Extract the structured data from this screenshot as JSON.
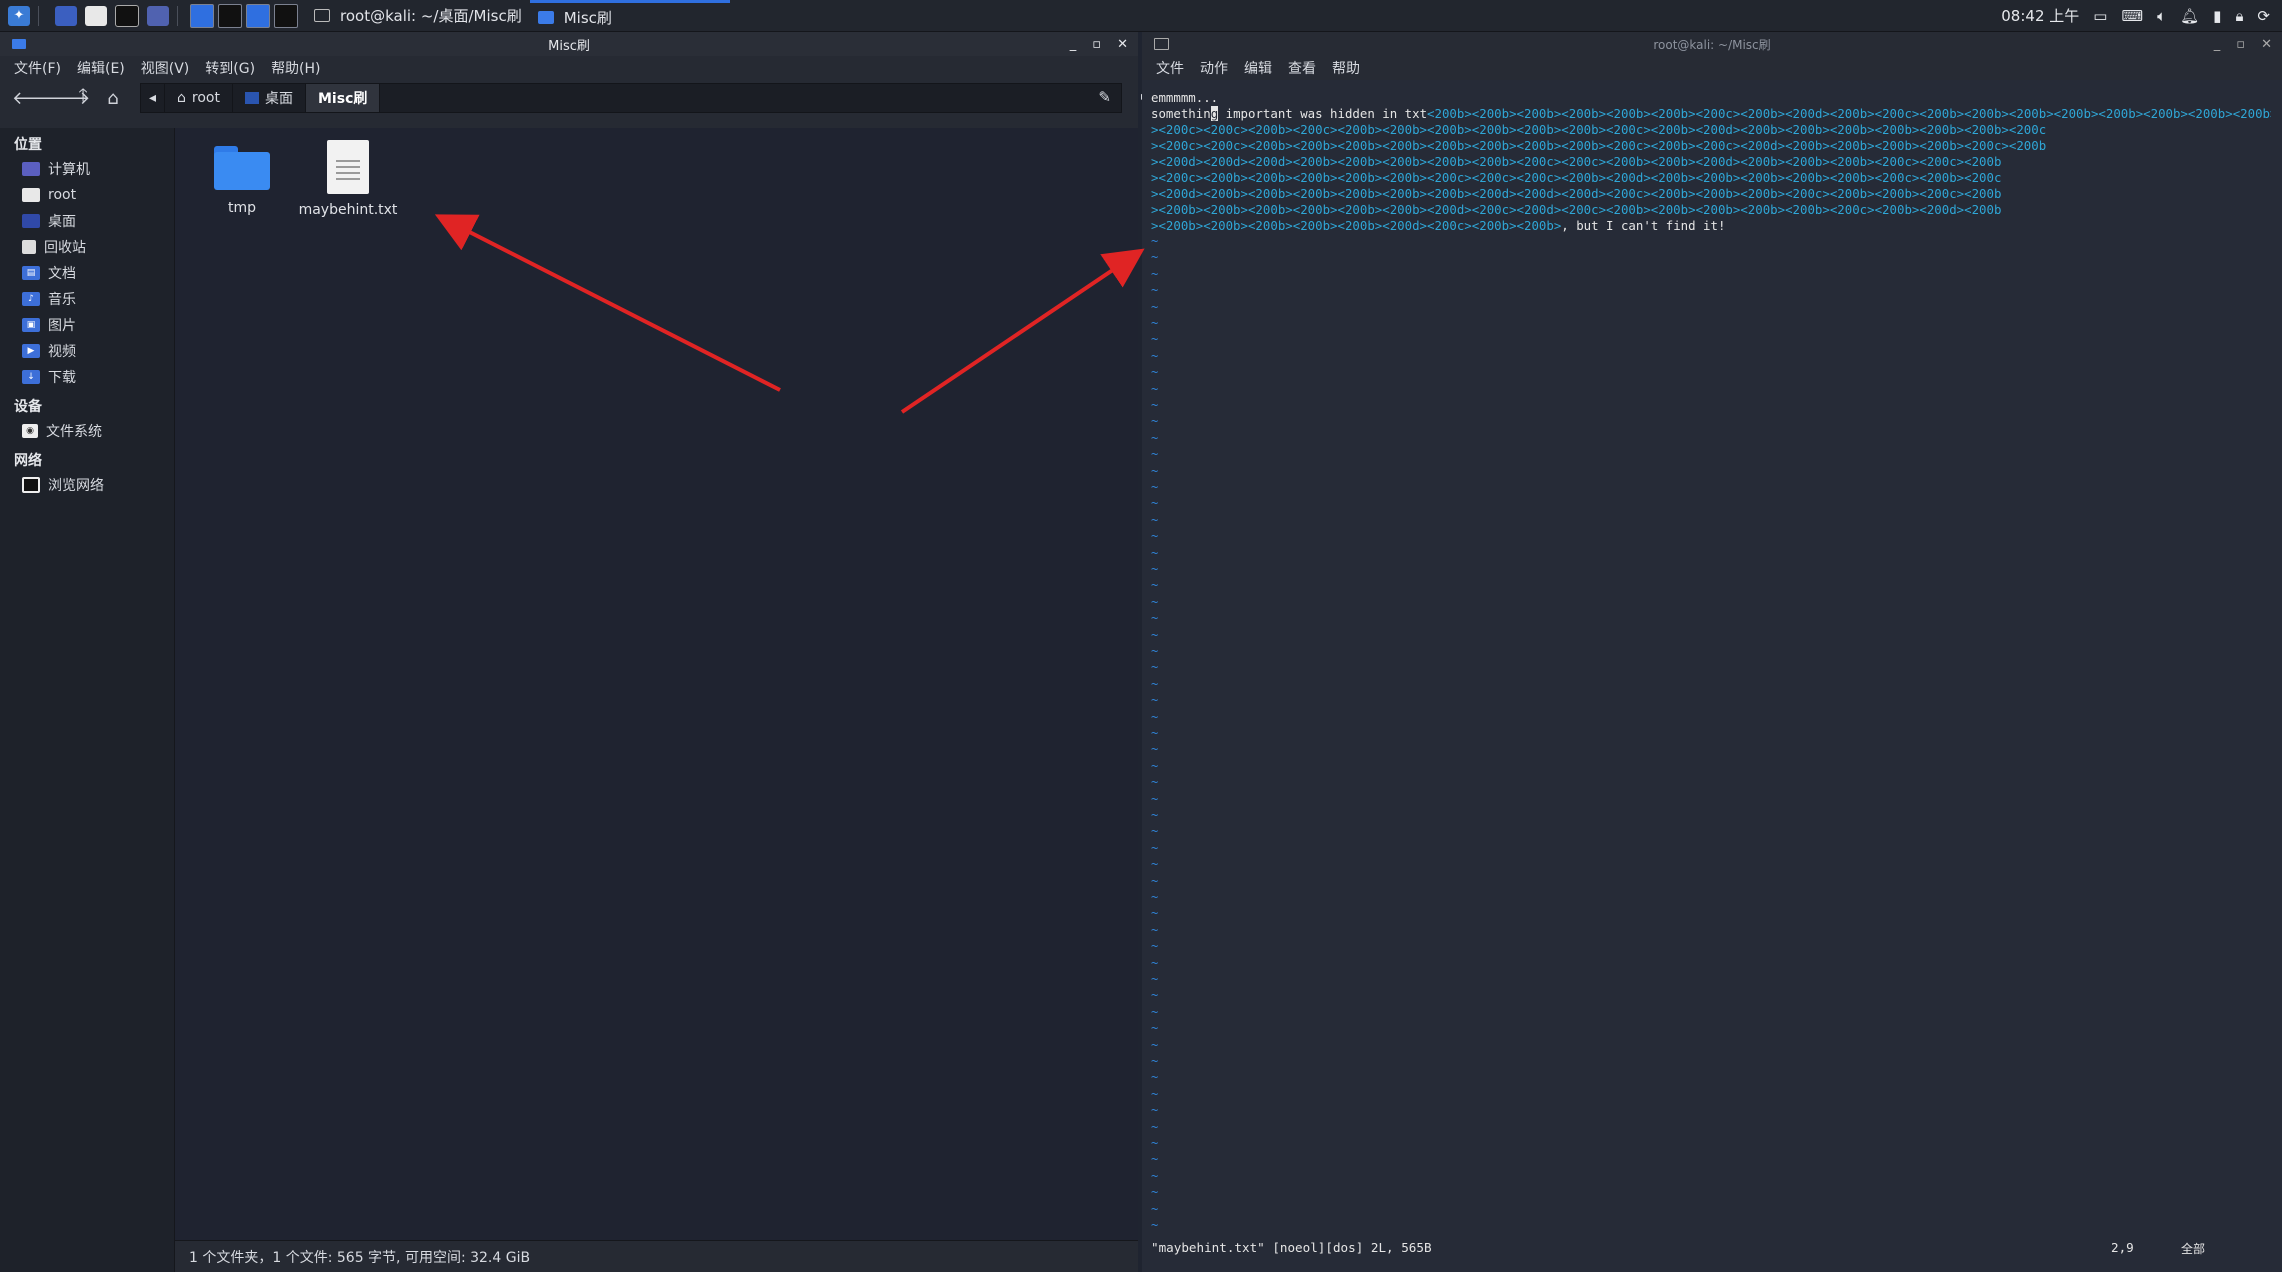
{
  "taskbar": {
    "tasks": [
      {
        "label": "root@kali: ~/桌面/Misc刷"
      },
      {
        "label": "Misc刷"
      }
    ],
    "clock": "08:42 上午"
  },
  "file_manager": {
    "title": "Misc刷",
    "menu": [
      "文件(F)",
      "编辑(E)",
      "视图(V)",
      "转到(G)",
      "帮助(H)"
    ],
    "path": [
      "root",
      "桌面",
      "Misc刷"
    ],
    "sidebar": {
      "places_header": "位置",
      "places": [
        "计算机",
        "root",
        "桌面",
        "回收站",
        "文档",
        "音乐",
        "图片",
        "视频",
        "下载"
      ],
      "devices_header": "设备",
      "devices": [
        "文件系统"
      ],
      "network_header": "网络",
      "network": [
        "浏览网络"
      ]
    },
    "files": [
      {
        "name": "tmp",
        "type": "folder"
      },
      {
        "name": "maybehint.txt",
        "type": "text"
      }
    ],
    "status": "1 个文件夹，1 个文件: 565 字节, 可用空间: 32.4 GiB"
  },
  "terminal": {
    "title": "root@kali: ~/Misc刷",
    "menu": [
      "文件",
      "动作",
      "编辑",
      "查看",
      "帮助"
    ],
    "vim": {
      "line1": "emmmmm...",
      "line2_prefix": "something important was hidden in txt",
      "hidden_rows": [
        "<200b><200b><200b><200b><200b><200b><200c><200b><200d><200b><200c><200b><200b><200b><200b><200b><200b><200b><200b>",
        "><200c><200c><200b><200c><200b><200b><200b><200b><200b><200b><200c><200b><200d><200b><200b><200b><200b><200b><200b><200c",
        "><200c><200c><200b><200b><200b><200b><200b><200b><200b><200b><200c><200b><200c><200d><200b><200b><200b><200b><200c><200b",
        "><200d><200d><200d><200b><200b><200b><200b><200b><200c><200c><200b><200b><200d><200b><200b><200b><200c><200c><200b",
        "><200c><200b><200b><200b><200b><200b><200c><200c><200c><200b><200d><200b><200b><200b><200b><200b><200c><200b><200c",
        "><200d><200b><200b><200b><200b><200b><200b><200d><200d><200d><200c><200b><200b><200b><200c><200b><200b><200c><200b",
        "><200b><200b><200b><200b><200b><200b><200d><200c><200d><200c><200b><200b><200b><200b><200b><200c><200b><200d><200b",
        "><200b><200b><200b><200b><200b><200d><200c><200b><200b>"
      ],
      "line2_suffix": ", but I can't find it!",
      "status_left": "\"maybehint.txt\" [noeol][dos] 2L, 565B",
      "status_pos": "2,9",
      "status_pct": "全部"
    }
  },
  "colors": {
    "accent": "#2f6fe0",
    "arrow": "#e02424",
    "zero_width": "#2fa6d6",
    "tilde": "#2f84d8"
  }
}
